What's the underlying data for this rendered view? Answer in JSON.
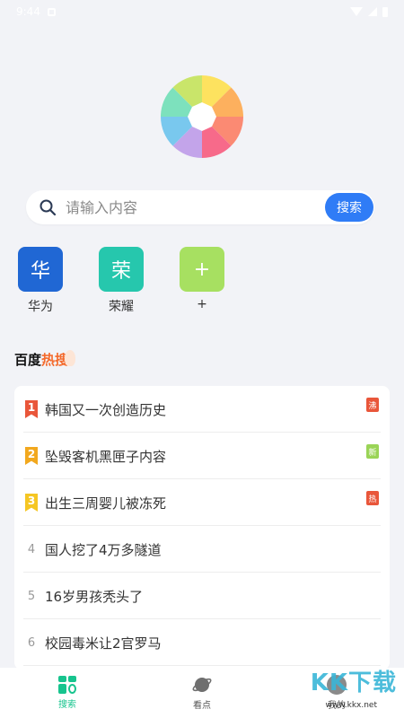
{
  "status_bar": {
    "time": "9:44"
  },
  "search": {
    "placeholder": "请输入内容",
    "button_label": "搜索"
  },
  "shortcuts": [
    {
      "glyph": "华",
      "label": "华为",
      "color": "#2067d4"
    },
    {
      "glyph": "荣",
      "label": "荣耀",
      "color": "#26c7ad"
    },
    {
      "glyph": "+",
      "label": "+",
      "color": "#a7e061"
    }
  ],
  "hot": {
    "title_part1": "百度",
    "title_part2": "热搜",
    "items": [
      {
        "rank": "1",
        "title": "韩国又一次创造历史",
        "tag": "沸",
        "rank_color": "#e9563a",
        "tag_color": "#e9563a"
      },
      {
        "rank": "2",
        "title": "坠毁客机黑匣子内容",
        "tag": "新",
        "rank_color": "#f2a81e",
        "tag_color": "#9ad456"
      },
      {
        "rank": "3",
        "title": "出生三周婴儿被冻死",
        "tag": "热",
        "rank_color": "#f5c623",
        "tag_color": "#e9563a"
      },
      {
        "rank": "4",
        "title": "国人挖了4万多隧道",
        "tag": ""
      },
      {
        "rank": "5",
        "title": "16岁男孩秃头了",
        "tag": ""
      },
      {
        "rank": "6",
        "title": "校园毒米让2官罗马",
        "tag": ""
      }
    ]
  },
  "nav": {
    "search_label": "搜索",
    "discover_label": "看点",
    "mine_label": "我的"
  },
  "watermark": {
    "main": "KK下载",
    "sub": "www.kkx.net"
  },
  "colors": {
    "accent": "#2f7cf6",
    "nav_active": "#17c48e",
    "hot_orange": "#f46a2c"
  }
}
